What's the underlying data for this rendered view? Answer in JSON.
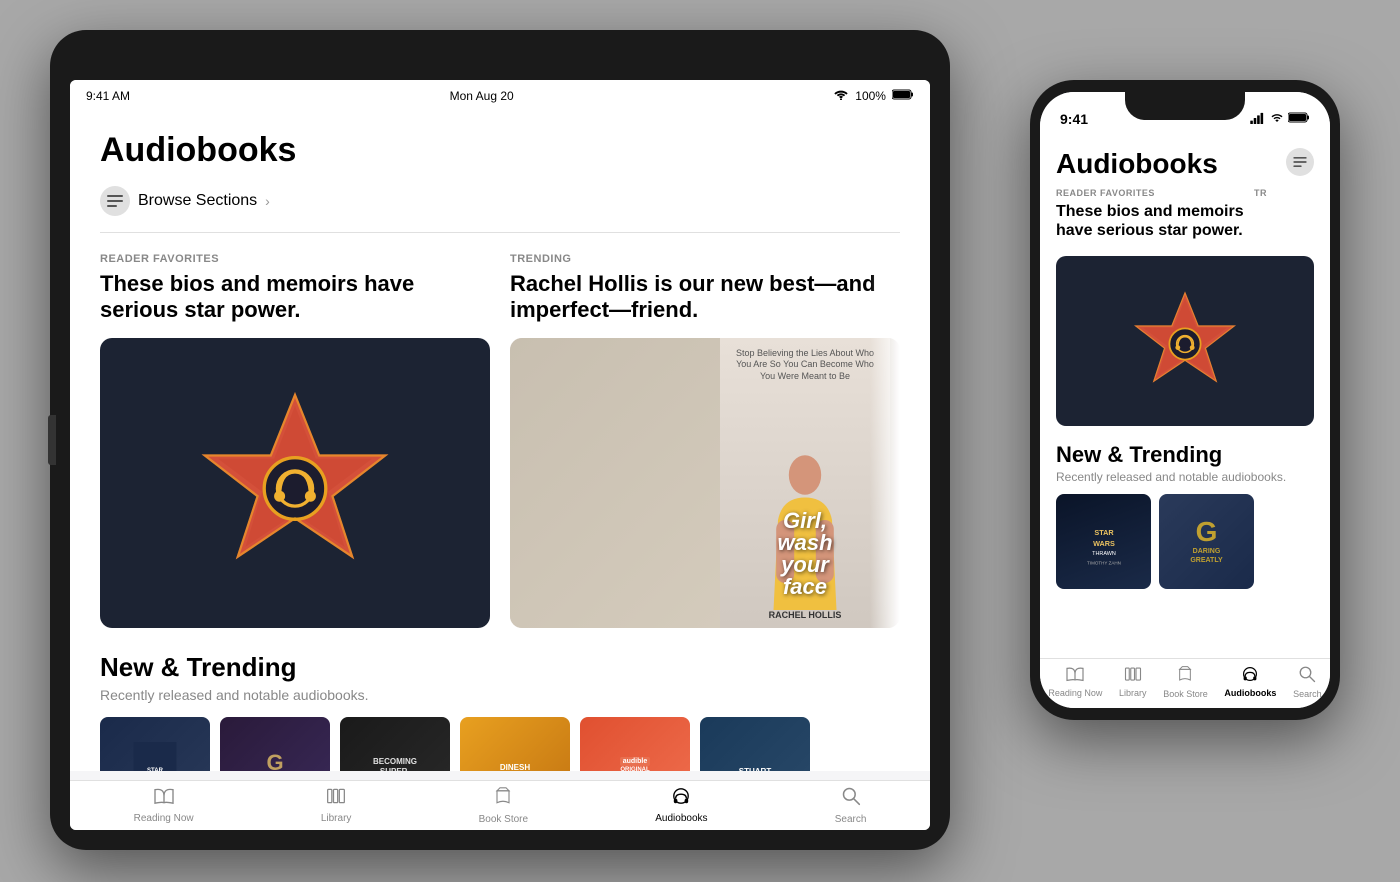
{
  "scene": {
    "background_color": "#a8a8a8"
  },
  "ipad": {
    "status_bar": {
      "time": "9:41 AM",
      "date": "Mon Aug 20",
      "wifi": "WiFi",
      "battery": "100%"
    },
    "screen": {
      "page_title": "Audiobooks",
      "browse_sections_label": "Browse Sections",
      "reader_favorites_label": "READER FAVORITES",
      "reader_favorites_title": "These bios and memoirs have serious star power.",
      "trending_label": "TRENDING",
      "trending_title": "Rachel Hollis is our new best—and imperfect—friend.",
      "new_trending_title": "New & Trending",
      "new_trending_subtitle": "Recently released and notable audiobooks."
    },
    "tabs": [
      {
        "label": "Reading Now",
        "icon": "book-open",
        "active": false
      },
      {
        "label": "Library",
        "icon": "building-columns",
        "active": false
      },
      {
        "label": "Book Store",
        "icon": "bag",
        "active": false
      },
      {
        "label": "Audiobooks",
        "icon": "headphones",
        "active": true
      },
      {
        "label": "Search",
        "icon": "magnifying-glass",
        "active": false
      }
    ]
  },
  "iphone": {
    "status_bar": {
      "time": "9:41",
      "signal": "full",
      "wifi": "WiFi",
      "battery": "full"
    },
    "screen": {
      "page_title": "Audiobooks",
      "reader_favorites_label": "READER FAVORITES",
      "reader_favorites_title": "These bios and memoirs have serious star power.",
      "trending_label": "TR",
      "new_trending_title": "New & Trending",
      "new_trending_subtitle": "Recently released and notable audiobooks."
    },
    "tabs": [
      {
        "label": "Reading Now",
        "icon": "book-open",
        "active": false
      },
      {
        "label": "Library",
        "icon": "building-columns",
        "active": false
      },
      {
        "label": "Book Store",
        "icon": "bag",
        "active": false
      },
      {
        "label": "Audiobooks",
        "icon": "headphones",
        "active": true
      },
      {
        "label": "Search",
        "icon": "magnifying-glass",
        "active": false
      }
    ]
  }
}
